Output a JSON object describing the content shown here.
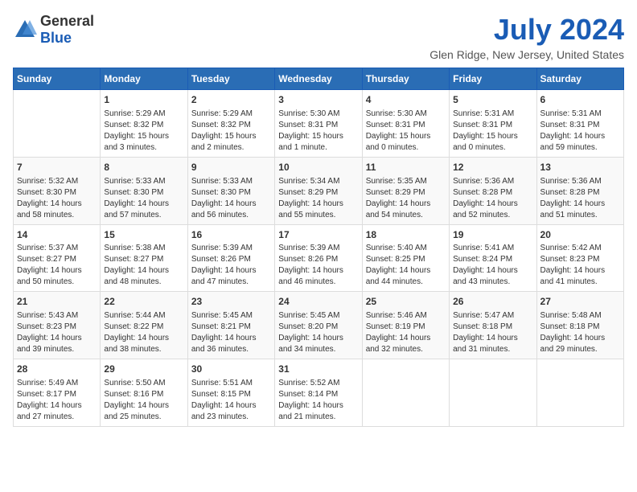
{
  "header": {
    "logo_general": "General",
    "logo_blue": "Blue",
    "month_title": "July 2024",
    "location": "Glen Ridge, New Jersey, United States"
  },
  "calendar": {
    "weekdays": [
      "Sunday",
      "Monday",
      "Tuesday",
      "Wednesday",
      "Thursday",
      "Friday",
      "Saturday"
    ],
    "weeks": [
      [
        {
          "day": "",
          "content": ""
        },
        {
          "day": "1",
          "content": "Sunrise: 5:29 AM\nSunset: 8:32 PM\nDaylight: 15 hours\nand 3 minutes."
        },
        {
          "day": "2",
          "content": "Sunrise: 5:29 AM\nSunset: 8:32 PM\nDaylight: 15 hours\nand 2 minutes."
        },
        {
          "day": "3",
          "content": "Sunrise: 5:30 AM\nSunset: 8:31 PM\nDaylight: 15 hours\nand 1 minute."
        },
        {
          "day": "4",
          "content": "Sunrise: 5:30 AM\nSunset: 8:31 PM\nDaylight: 15 hours\nand 0 minutes."
        },
        {
          "day": "5",
          "content": "Sunrise: 5:31 AM\nSunset: 8:31 PM\nDaylight: 15 hours\nand 0 minutes."
        },
        {
          "day": "6",
          "content": "Sunrise: 5:31 AM\nSunset: 8:31 PM\nDaylight: 14 hours\nand 59 minutes."
        }
      ],
      [
        {
          "day": "7",
          "content": "Sunrise: 5:32 AM\nSunset: 8:30 PM\nDaylight: 14 hours\nand 58 minutes."
        },
        {
          "day": "8",
          "content": "Sunrise: 5:33 AM\nSunset: 8:30 PM\nDaylight: 14 hours\nand 57 minutes."
        },
        {
          "day": "9",
          "content": "Sunrise: 5:33 AM\nSunset: 8:30 PM\nDaylight: 14 hours\nand 56 minutes."
        },
        {
          "day": "10",
          "content": "Sunrise: 5:34 AM\nSunset: 8:29 PM\nDaylight: 14 hours\nand 55 minutes."
        },
        {
          "day": "11",
          "content": "Sunrise: 5:35 AM\nSunset: 8:29 PM\nDaylight: 14 hours\nand 54 minutes."
        },
        {
          "day": "12",
          "content": "Sunrise: 5:36 AM\nSunset: 8:28 PM\nDaylight: 14 hours\nand 52 minutes."
        },
        {
          "day": "13",
          "content": "Sunrise: 5:36 AM\nSunset: 8:28 PM\nDaylight: 14 hours\nand 51 minutes."
        }
      ],
      [
        {
          "day": "14",
          "content": "Sunrise: 5:37 AM\nSunset: 8:27 PM\nDaylight: 14 hours\nand 50 minutes."
        },
        {
          "day": "15",
          "content": "Sunrise: 5:38 AM\nSunset: 8:27 PM\nDaylight: 14 hours\nand 48 minutes."
        },
        {
          "day": "16",
          "content": "Sunrise: 5:39 AM\nSunset: 8:26 PM\nDaylight: 14 hours\nand 47 minutes."
        },
        {
          "day": "17",
          "content": "Sunrise: 5:39 AM\nSunset: 8:26 PM\nDaylight: 14 hours\nand 46 minutes."
        },
        {
          "day": "18",
          "content": "Sunrise: 5:40 AM\nSunset: 8:25 PM\nDaylight: 14 hours\nand 44 minutes."
        },
        {
          "day": "19",
          "content": "Sunrise: 5:41 AM\nSunset: 8:24 PM\nDaylight: 14 hours\nand 43 minutes."
        },
        {
          "day": "20",
          "content": "Sunrise: 5:42 AM\nSunset: 8:23 PM\nDaylight: 14 hours\nand 41 minutes."
        }
      ],
      [
        {
          "day": "21",
          "content": "Sunrise: 5:43 AM\nSunset: 8:23 PM\nDaylight: 14 hours\nand 39 minutes."
        },
        {
          "day": "22",
          "content": "Sunrise: 5:44 AM\nSunset: 8:22 PM\nDaylight: 14 hours\nand 38 minutes."
        },
        {
          "day": "23",
          "content": "Sunrise: 5:45 AM\nSunset: 8:21 PM\nDaylight: 14 hours\nand 36 minutes."
        },
        {
          "day": "24",
          "content": "Sunrise: 5:45 AM\nSunset: 8:20 PM\nDaylight: 14 hours\nand 34 minutes."
        },
        {
          "day": "25",
          "content": "Sunrise: 5:46 AM\nSunset: 8:19 PM\nDaylight: 14 hours\nand 32 minutes."
        },
        {
          "day": "26",
          "content": "Sunrise: 5:47 AM\nSunset: 8:18 PM\nDaylight: 14 hours\nand 31 minutes."
        },
        {
          "day": "27",
          "content": "Sunrise: 5:48 AM\nSunset: 8:18 PM\nDaylight: 14 hours\nand 29 minutes."
        }
      ],
      [
        {
          "day": "28",
          "content": "Sunrise: 5:49 AM\nSunset: 8:17 PM\nDaylight: 14 hours\nand 27 minutes."
        },
        {
          "day": "29",
          "content": "Sunrise: 5:50 AM\nSunset: 8:16 PM\nDaylight: 14 hours\nand 25 minutes."
        },
        {
          "day": "30",
          "content": "Sunrise: 5:51 AM\nSunset: 8:15 PM\nDaylight: 14 hours\nand 23 minutes."
        },
        {
          "day": "31",
          "content": "Sunrise: 5:52 AM\nSunset: 8:14 PM\nDaylight: 14 hours\nand 21 minutes."
        },
        {
          "day": "",
          "content": ""
        },
        {
          "day": "",
          "content": ""
        },
        {
          "day": "",
          "content": ""
        }
      ]
    ]
  }
}
